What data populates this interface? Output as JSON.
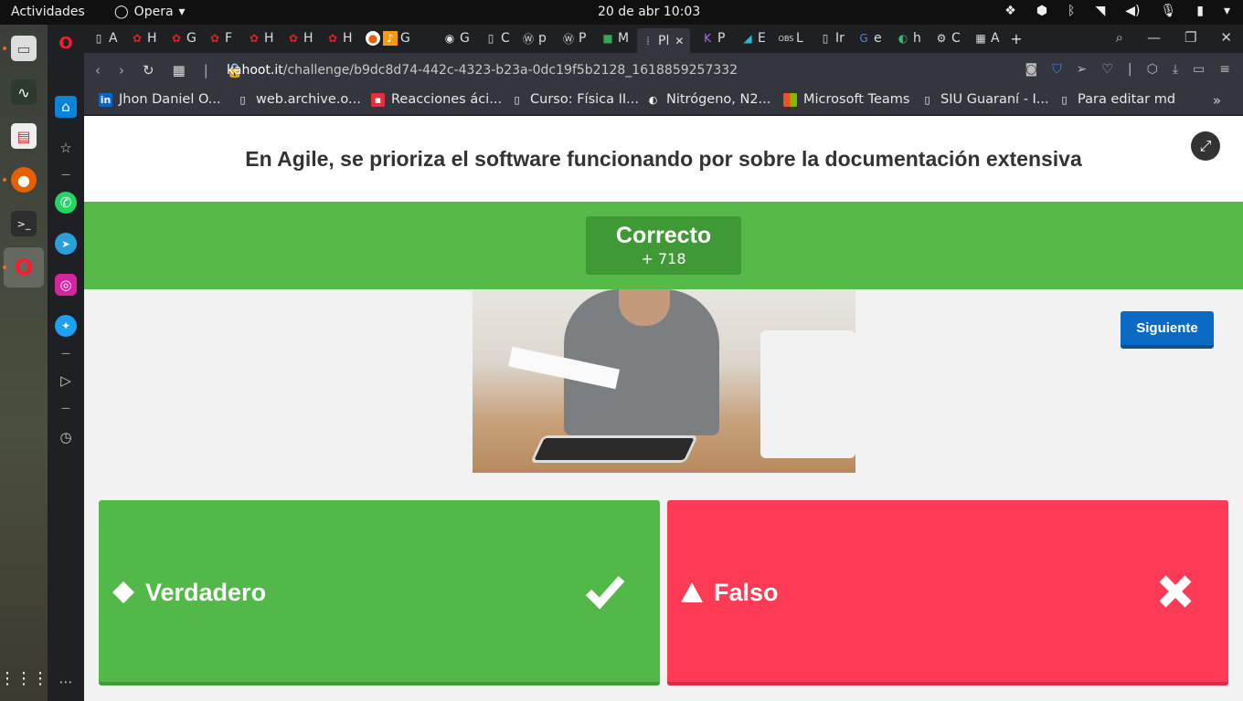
{
  "topbar": {
    "activities": "Actividades",
    "app_name": "Opera",
    "clock": "20 de abr  10:03"
  },
  "tabs": [
    {
      "label": "A"
    },
    {
      "label": "H"
    },
    {
      "label": "G"
    },
    {
      "label": "F"
    },
    {
      "label": "H"
    },
    {
      "label": "H"
    },
    {
      "label": "H"
    },
    {
      "label": "G"
    },
    {
      "label": "G"
    },
    {
      "label": "C"
    },
    {
      "label": "p"
    },
    {
      "label": "P"
    },
    {
      "label": "M"
    },
    {
      "label": "Pl"
    },
    {
      "label": "P"
    },
    {
      "label": "E"
    },
    {
      "label": "L"
    },
    {
      "label": "Ir"
    },
    {
      "label": "e"
    },
    {
      "label": "h"
    },
    {
      "label": "C"
    },
    {
      "label": "A"
    }
  ],
  "address": {
    "host": "kahoot.it",
    "path": "/challenge/b9dc8d74-442c-4323-b23a-0dc19f5b2128_1618859257332"
  },
  "bookmarks": [
    {
      "label": "Jhon Daniel O...",
      "icon": "linkedin-icon",
      "color": "#0a66c2"
    },
    {
      "label": "web.archive.o...",
      "icon": "page-icon",
      "color": "#ffffff"
    },
    {
      "label": "Reacciones áci...",
      "icon": "page-icon",
      "color": "#e2313c"
    },
    {
      "label": "Curso: Física II...",
      "icon": "page-icon",
      "color": "#ffffff"
    },
    {
      "label": "Nitrógeno, N2...",
      "icon": "globe-icon",
      "color": "#ffffff"
    },
    {
      "label": "Microsoft Teams",
      "icon": "microsoft-icon",
      "color": "#f25022"
    },
    {
      "label": "SIU Guaraní - I...",
      "icon": "page-icon",
      "color": "#ffffff"
    },
    {
      "label": "Para editar md",
      "icon": "page-icon",
      "color": "#ffffff"
    }
  ],
  "quiz": {
    "question": "En Agile, se prioriza el software funcionando por sobre la documentación extensiva",
    "result_label": "Correcto",
    "points": "+ 718",
    "next_button": "Siguiente",
    "answers": [
      {
        "label": "Verdadero",
        "shape": "diamond-icon",
        "mark": "check-icon",
        "color": "#52b848"
      },
      {
        "label": "Falso",
        "shape": "triangle-icon",
        "mark": "cross-icon",
        "color": "#ff3a55"
      }
    ]
  },
  "colors": {
    "correct_green": "#55ba48",
    "dark_green": "#3f9a35",
    "wrong_red": "#ff3a55",
    "next_blue": "#0b6bc4"
  }
}
